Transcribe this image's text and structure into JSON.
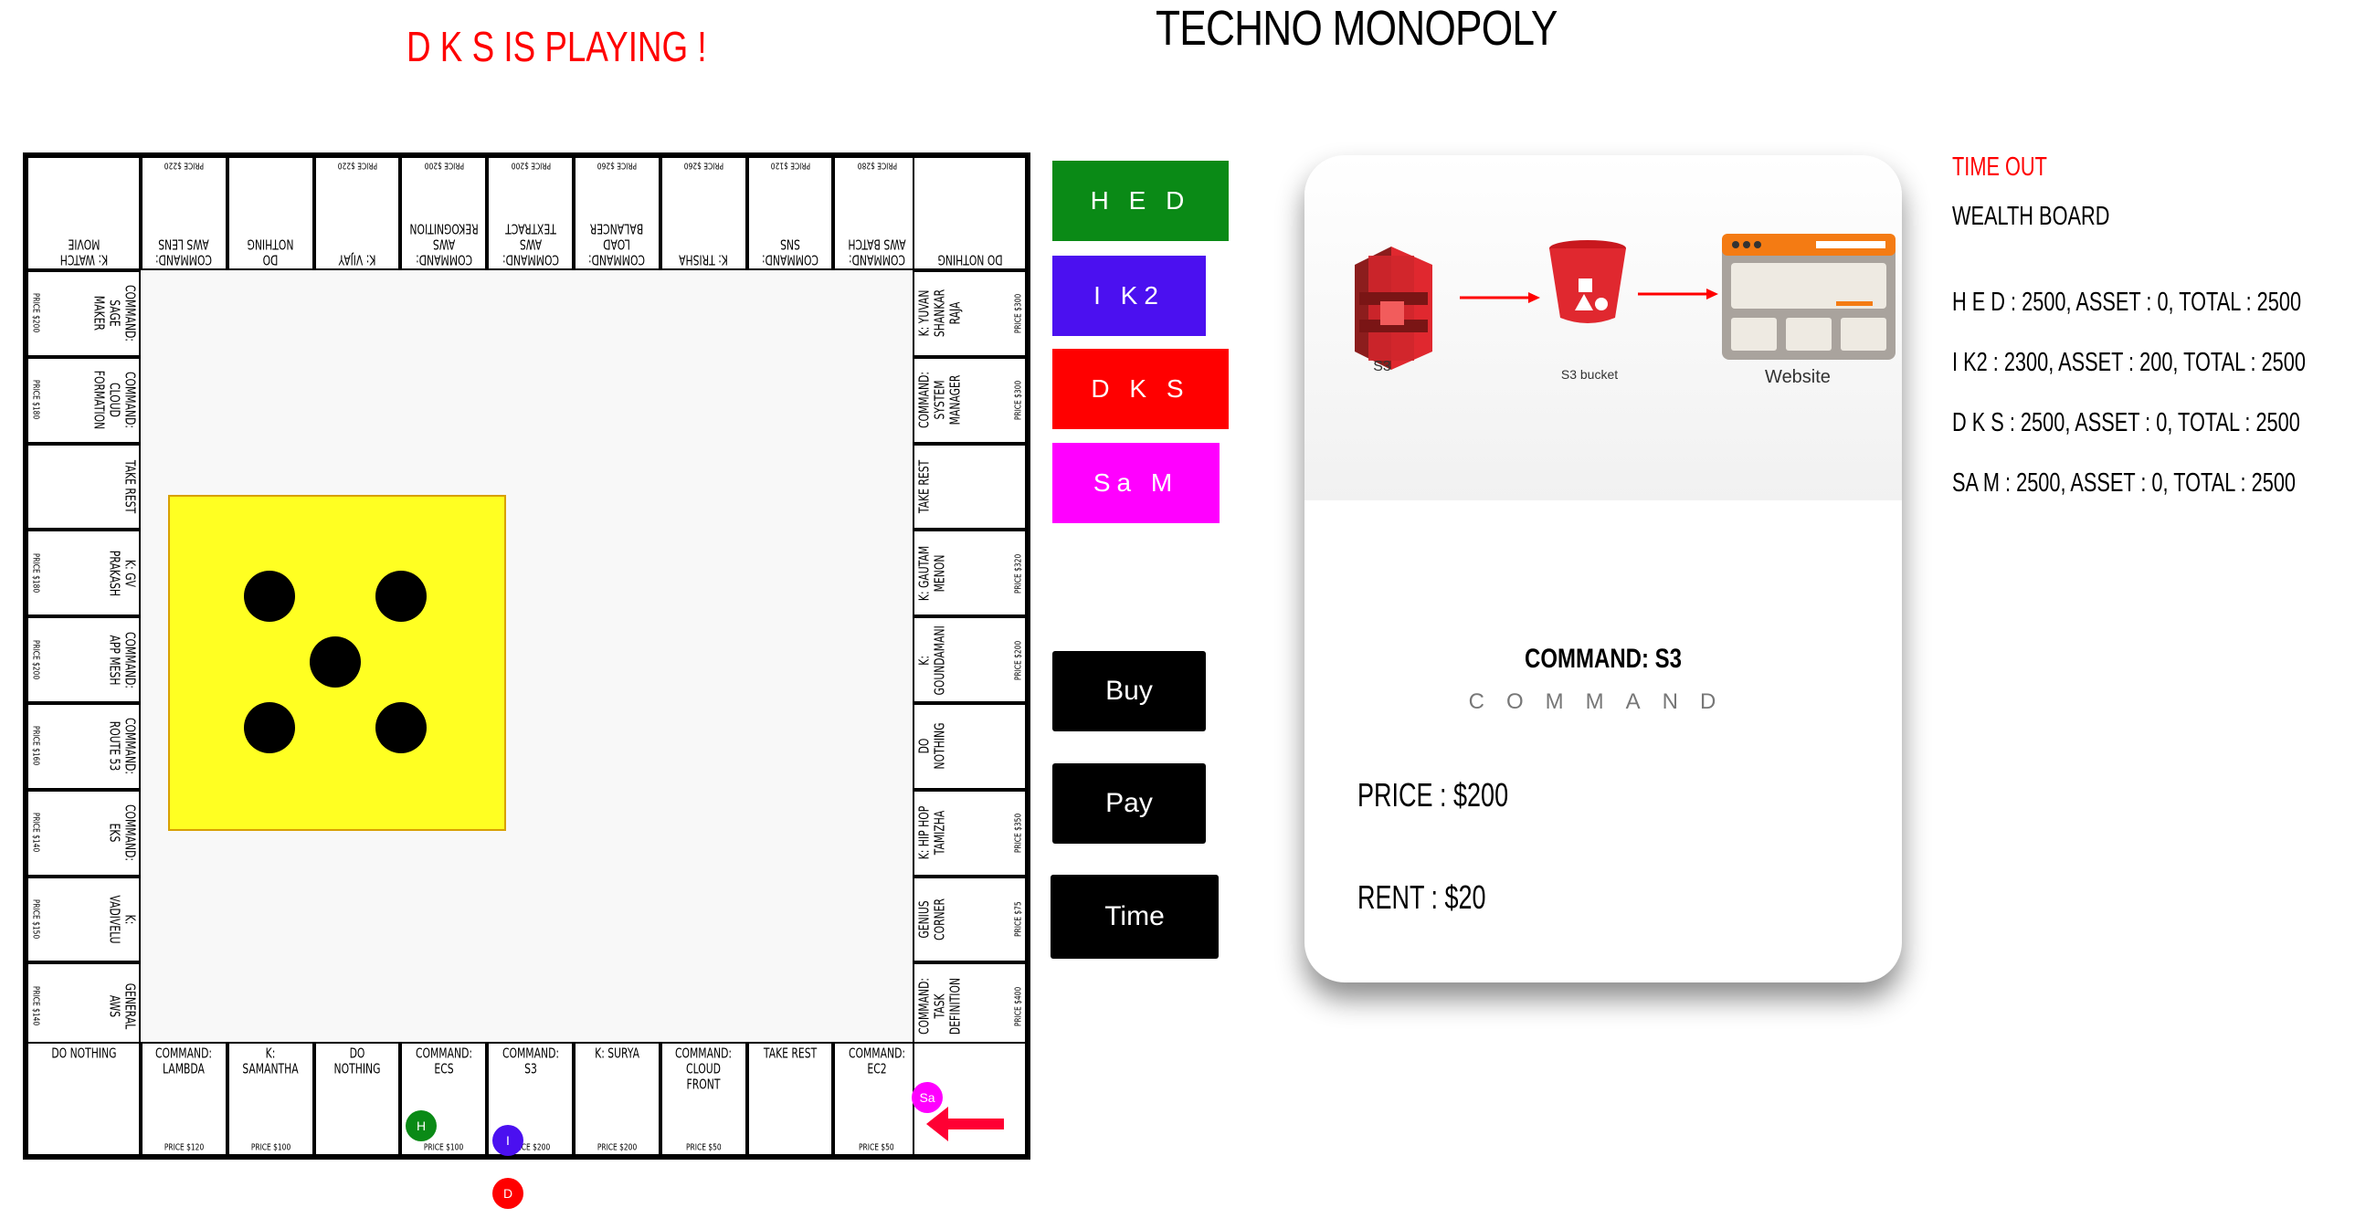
{
  "header": {
    "title": "TECHNO MONOPOLY",
    "status": "D K S IS PLAYING !"
  },
  "board": {
    "top": [
      {
        "name": "K: WATCH MOVIE",
        "price": ""
      },
      {
        "name": "COMMAND: AWS LENS",
        "price": "PRICE $220"
      },
      {
        "name": "DO NOTHING",
        "price": ""
      },
      {
        "name": "K: VIJAY",
        "price": "PRICE $220"
      },
      {
        "name": "COMMAND: AWS REKOGNITION",
        "price": "PRICE $200"
      },
      {
        "name": "COMMAND: AWS TEXTRACT",
        "price": "PRICE $200"
      },
      {
        "name": "COMMAND: LOAD BALANCER",
        "price": "PRICE $260"
      },
      {
        "name": "K: TRISHA",
        "price": "PRICE $260"
      },
      {
        "name": "COMMAND: SNS",
        "price": "PRICE $120"
      },
      {
        "name": "COMMAND: AWS BATCH",
        "price": "PRICE $280"
      },
      {
        "name": "DO NOTHING",
        "price": ""
      }
    ],
    "left": [
      {
        "name": "COMMAND: SAGE MAKER",
        "price": "PRICE $200"
      },
      {
        "name": "COMMAND: CLOUD FORMATION",
        "price": "PRICE $180"
      },
      {
        "name": "TAKE REST",
        "price": ""
      },
      {
        "name": "K: GV PRAKASH",
        "price": "PRICE $180"
      },
      {
        "name": "COMMAND: APP MESH",
        "price": "PRICE $200"
      },
      {
        "name": "COMMAND: ROUTE 53",
        "price": "PRICE $160"
      },
      {
        "name": "COMMAND: EKS",
        "price": "PRICE $140"
      },
      {
        "name": "K: VADIVELU",
        "price": "PRICE $150"
      },
      {
        "name": "GENERAL AWS",
        "price": "PRICE $140"
      }
    ],
    "right": [
      {
        "name": "K: YUVAN SHANKAR RAJA",
        "price": "PRICE $300"
      },
      {
        "name": "COMMAND: SYSTEM MANAGER",
        "price": "PRICE $300"
      },
      {
        "name": "TAKE REST",
        "price": ""
      },
      {
        "name": "K: GAUTAM MENON",
        "price": "PRICE $320"
      },
      {
        "name": "K: GOUNDAMANI",
        "price": "PRICE $200"
      },
      {
        "name": "DO NOTHING",
        "price": ""
      },
      {
        "name": "K: HIP HOP TAMIZHA",
        "price": "PRICE $350"
      },
      {
        "name": "GENIUS CORNER",
        "price": "PRICE $75"
      },
      {
        "name": "COMMAND: TASK DEFINITION",
        "price": "PRICE $400"
      }
    ],
    "bottom": [
      {
        "name": "DO NOTHING",
        "price": ""
      },
      {
        "name": "COMMAND: LAMBDA",
        "price": "PRICE $120"
      },
      {
        "name": "K: SAMANTHA",
        "price": "PRICE $100"
      },
      {
        "name": "DO NOTHING",
        "price": ""
      },
      {
        "name": "COMMAND: ECS",
        "price": "PRICE $100"
      },
      {
        "name": "COMMAND: S3",
        "price": "PRICE $200"
      },
      {
        "name": "K: SURYA",
        "price": "PRICE $200"
      },
      {
        "name": "COMMAND: CLOUD FRONT",
        "price": "PRICE $50"
      },
      {
        "name": "TAKE REST",
        "price": ""
      },
      {
        "name": "COMMAND: EC2",
        "price": "PRICE $50"
      },
      {
        "name": "",
        "price": ""
      }
    ]
  },
  "dice": {
    "value": 5
  },
  "players": [
    {
      "label": "H E D",
      "color": "#0a8a16",
      "token": "H"
    },
    {
      "label": "I K2",
      "color": "#4b10f0",
      "token": "I"
    },
    {
      "label": "D K S",
      "color": "#ff0000",
      "token": "D"
    },
    {
      "label": "Sa M",
      "color": "#ff00ff",
      "token": "Sa"
    }
  ],
  "actions": {
    "buy": "Buy",
    "pay": "Pay",
    "time": "Time"
  },
  "card": {
    "title": "COMMAND: S3",
    "subtitle": "COMMAND",
    "price": "PRICE : $200",
    "rent": "RENT : $20",
    "diagram": {
      "s3_label": "S3",
      "bucket_label": "S3 bucket",
      "website_label": "Website"
    }
  },
  "side": {
    "timeout": "TIME OUT",
    "wealth_title": "WEALTH BOARD",
    "wealth": [
      "H E D : 2500, ASSET : 0, TOTAL : 2500",
      "I K2 : 2300, ASSET : 200, TOTAL : 2500",
      "D K S : 2500, ASSET : 0, TOTAL : 2500",
      "SA M : 2500, ASSET : 0, TOTAL : 2500"
    ]
  }
}
